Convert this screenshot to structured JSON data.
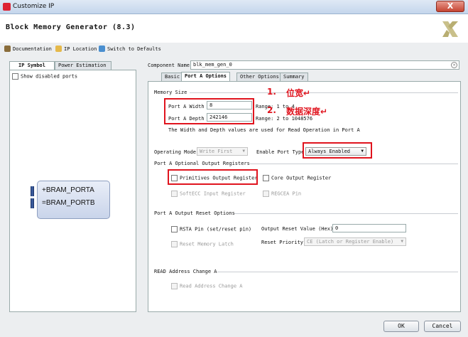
{
  "window": {
    "title": "Customize IP",
    "close_label": "X"
  },
  "header": {
    "title": "Block Memory Generator (8.3)",
    "logo_icon": "xilinx-logo"
  },
  "toolbar": {
    "documentation": "Documentation",
    "ip_location": "IP Location",
    "switch_defaults": "Switch to Defaults"
  },
  "left": {
    "tabs": [
      "IP Symbol",
      "Power Estimation"
    ],
    "show_disabled_ports": "Show disabled ports",
    "symbol_ports": [
      "BRAM_PORTA",
      "BRAM_PORTB"
    ]
  },
  "component": {
    "label": "Component Name",
    "value": "blk_mem_gen_0"
  },
  "tabs": [
    "Basic",
    "Port A Options",
    "Other Options",
    "Summary"
  ],
  "active_tab": "Port A Options",
  "memory_size": {
    "title": "Memory Size",
    "width_label": "Port A Width",
    "width_value": "8",
    "width_range": "Range: 1 to 4",
    "depth_label": "Port A Depth",
    "depth_value": "242146",
    "depth_range": "Range: 2 to 1048576",
    "note": "The Width and Depth values are used for Read Operation in Port A"
  },
  "annotations": {
    "a1": "1.",
    "a1_text": "位宽↵",
    "a2": "2.",
    "a2_text": "数据深度↵"
  },
  "operating_mode": {
    "label": "Operating Mode",
    "value": "Write First"
  },
  "enable_port": {
    "label": "Enable Port Type",
    "value": "Always Enabled"
  },
  "optional_regs": {
    "title": "Port A Optional Output Registers",
    "primitives": "Primitives Output Register",
    "core": "Core Output Register",
    "softecc": "SoftECC Input Register",
    "regcea": "REGCEA Pin"
  },
  "reset_options": {
    "title": "Port A Output Reset Options",
    "rsta": "RSTA Pin (set/reset pin)",
    "output_reset_label": "Output Reset Value (Hex)",
    "output_reset_value": "0",
    "reset_latch": "Reset Memory Latch",
    "reset_priority_label": "Reset Priority",
    "reset_priority_value": "CE (Latch or Register Enable)"
  },
  "read_address": {
    "title": "READ Address Change A",
    "option": "Read Address Change A"
  },
  "buttons": {
    "ok": "OK",
    "cancel": "Cancel"
  },
  "colors": {
    "annotation": "#e0141e",
    "title_bar": "#c4d6ec"
  }
}
